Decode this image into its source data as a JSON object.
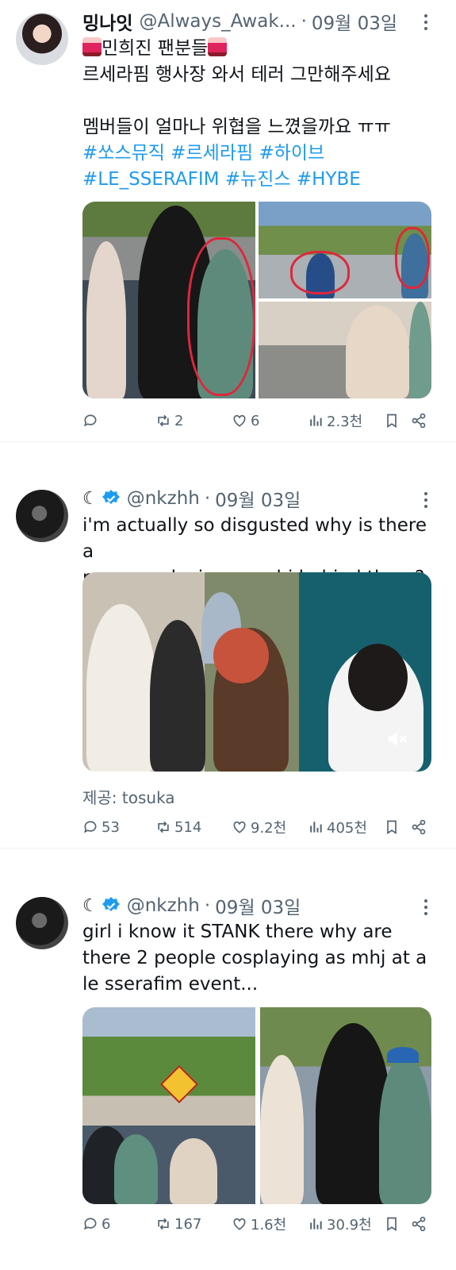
{
  "tweets": [
    {
      "display_name": "밍나잇",
      "handle": "@Always_Awak...",
      "date": "09월 03일",
      "text_lines": [
        "민희진 팬분들",
        "르세라핌 행사장 와서 테러 그만해주세요",
        "",
        "멤버들이 얼마나 위협을 느꼈을까요 ㅠㅠ"
      ],
      "hashtags_line1": [
        "#쏘스뮤직",
        "#르세라핌",
        "#하이브"
      ],
      "hashtags_line2": [
        "#LE_SSERAFIM",
        "#뉴진스",
        "#HYBE"
      ],
      "stats": {
        "replies": "",
        "retweets": "2",
        "likes": "6",
        "views": "2.3천"
      }
    },
    {
      "display_name": "☾",
      "handle": "@nkzhh",
      "date": "09월 03일",
      "text_lines": [
        "i'm actually so disgusted why is there a",
        "man cosplaying as mhj behind them?"
      ],
      "media_caption": "제공: tosuka",
      "stats": {
        "replies": "53",
        "retweets": "514",
        "likes": "9.2천",
        "views": "405천"
      }
    },
    {
      "display_name": "☾",
      "handle": "@nkzhh",
      "date": "09월 03일",
      "text_lines": [
        "girl i know it STANK there why are",
        "there 2 people cosplaying as mhj at a",
        "le sserafim event..."
      ],
      "stats": {
        "replies": "6",
        "retweets": "167",
        "likes": "1.6천",
        "views": "30.9천"
      }
    }
  ],
  "colors": {
    "link": "#1d9bf0",
    "muted": "#536471",
    "verified": "#1d9bf0",
    "text": "#0f1419"
  },
  "icons": [
    "reply-icon",
    "retweet-icon",
    "like-icon",
    "views-icon",
    "bookmark-icon",
    "share-icon",
    "more-icon",
    "verified-badge-icon",
    "siren-emoji",
    "mute-icon"
  ]
}
